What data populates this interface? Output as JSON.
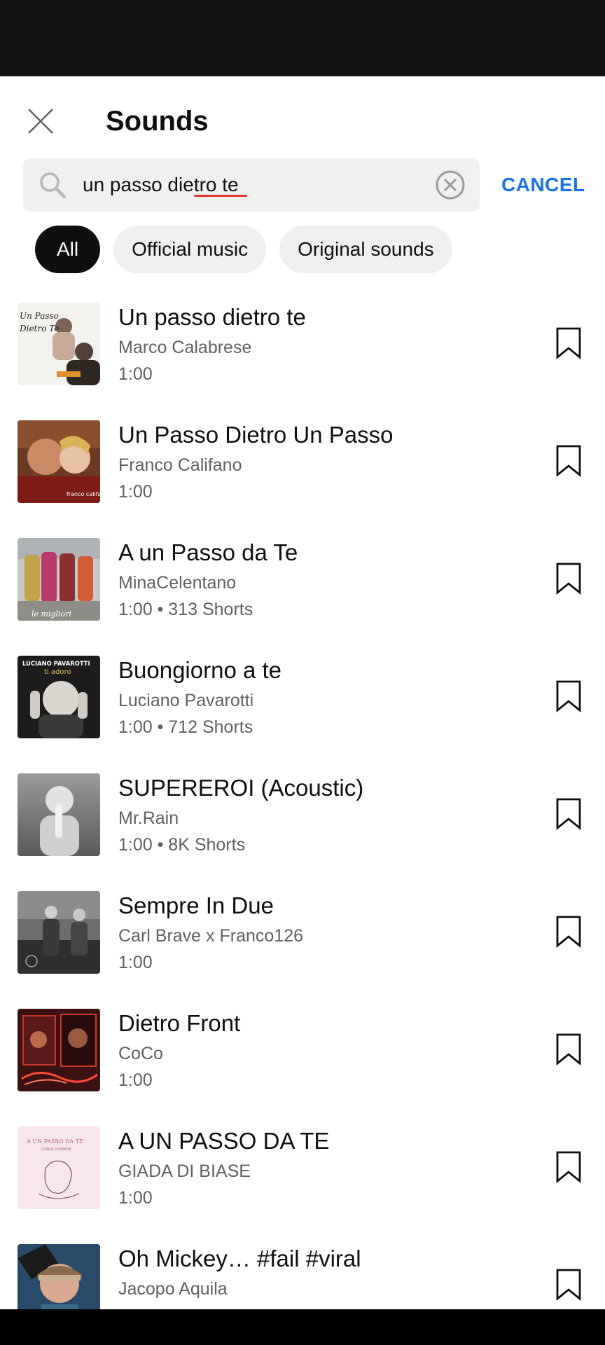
{
  "header": {
    "title": "Sounds"
  },
  "search": {
    "query": "un passo dietro te",
    "cancel_label": "CANCEL"
  },
  "filters": [
    {
      "label": "All",
      "active": true
    },
    {
      "label": "Official music",
      "active": false
    },
    {
      "label": "Original sounds",
      "active": false
    }
  ],
  "tracks": [
    {
      "title": "Un passo dietro te",
      "artist": "Marco Calabrese",
      "meta": "1:00"
    },
    {
      "title": "Un Passo Dietro Un Passo",
      "artist": "Franco Califano",
      "meta": "1:00"
    },
    {
      "title": "A un Passo da Te",
      "artist": "MinaCelentano",
      "meta": "1:00 • 313 Shorts"
    },
    {
      "title": "Buongiorno a te",
      "artist": "Luciano Pavarotti",
      "meta": "1:00 • 712 Shorts"
    },
    {
      "title": "SUPEREROI (Acoustic)",
      "artist": "Mr.Rain",
      "meta": "1:00 • 8K Shorts"
    },
    {
      "title": "Sempre In Due",
      "artist": "Carl Brave x Franco126",
      "meta": "1:00"
    },
    {
      "title": "Dietro Front",
      "artist": "CoCo",
      "meta": "1:00"
    },
    {
      "title": "A UN PASSO DA TE",
      "artist": "GIADA DI BIASE",
      "meta": "1:00"
    },
    {
      "title": "Oh Mickey… #fail #viral",
      "artist": "Jacopo Aquila",
      "meta": ""
    }
  ],
  "artwork_text": {
    "t1_line1": "Un Passo",
    "t1_line2": "Dietro Te",
    "t2_caption": "franco califano",
    "t3_caption": "le migliori",
    "t4_line1": "LUCIANO PAVAROTTI",
    "t4_line2": "ti adoro",
    "t8_line1": "A UN PASSO DA TE",
    "t8_line2": "GIADA DI BIASE"
  },
  "icons": {
    "close": "close-icon",
    "search": "search-icon",
    "clear": "clear-circle-icon",
    "bookmark": "bookmark-icon"
  },
  "colors": {
    "accent": "#1a73e8",
    "chip_active_bg": "#0f0f0f",
    "chip_bg": "#efefef"
  }
}
